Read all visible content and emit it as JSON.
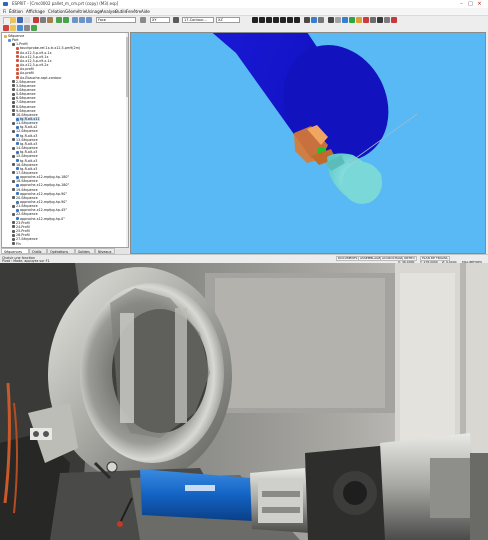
{
  "window": {
    "title": "ESPRIT - [Cmc0002 pallet_m_cm.prt (copy) (M3).esp]",
    "controls": [
      "minimize",
      "maximize",
      "close"
    ]
  },
  "menu": {
    "items": [
      "Fi",
      "Édition",
      "Affichage",
      "Création",
      "Géométrie",
      "Usinage",
      "Analyse",
      "Outils",
      "Fenêtre",
      "Aide"
    ]
  },
  "toolbar": {
    "combos": [
      {
        "name": "view",
        "value": "Face"
      },
      {
        "name": "grid",
        "value": "XY"
      },
      {
        "name": "workplane",
        "value": "XY"
      },
      {
        "name": "operation",
        "value": "17-Contour..."
      },
      {
        "name": "tool",
        "value": "XZ"
      }
    ]
  },
  "tree": {
    "rows": [
      {
        "label": "Séquence",
        "depth": 0,
        "icon": "folder-icon"
      },
      {
        "label": "Part",
        "depth": 1,
        "icon": "part-icon"
      },
      {
        "label": "1-Profil",
        "depth": 2,
        "icon": "op-icon"
      },
      {
        "label": "touchprobe-ref-1x-tr-x12,5-pm9(2m)",
        "depth": 3,
        "icon": "probe-icon"
      },
      {
        "label": "Ax-x12,5-p-x9-x-1x",
        "depth": 3,
        "icon": "probe-icon"
      },
      {
        "label": "Ax-x12,5-p-x9-1x",
        "depth": 3,
        "icon": "probe-icon"
      },
      {
        "label": "Ax-x12,5-p-x9-x-1x",
        "depth": 3,
        "icon": "probe-icon"
      },
      {
        "label": "Ax-x12,5-p-x9-2x",
        "depth": 3,
        "icon": "probe-icon"
      },
      {
        "label": "Ax-profil",
        "depth": 3,
        "icon": "probe-icon"
      },
      {
        "label": "Ax-profil",
        "depth": 3,
        "icon": "probe-icon"
      },
      {
        "label": "Ax-Ébauche-rapt-contour",
        "depth": 3,
        "icon": "probe-icon"
      },
      {
        "label": "2-Séquence",
        "depth": 2,
        "icon": "op-icon"
      },
      {
        "label": "3-Séquence",
        "depth": 2,
        "icon": "op-icon"
      },
      {
        "label": "4-Séquence",
        "depth": 2,
        "icon": "op-icon"
      },
      {
        "label": "5-Séquence",
        "depth": 2,
        "icon": "op-icon"
      },
      {
        "label": "6-Séquence",
        "depth": 2,
        "icon": "op-icon"
      },
      {
        "label": "7-Séquence",
        "depth": 2,
        "icon": "op-icon"
      },
      {
        "label": "8-Séquence",
        "depth": 2,
        "icon": "op-icon"
      },
      {
        "label": "9-Séquence",
        "depth": 2,
        "icon": "op-icon"
      },
      {
        "label": "10-Séquence",
        "depth": 2,
        "icon": "op-icon"
      },
      {
        "label": "tg-R-alt-x11",
        "depth": 3,
        "icon": "tool-icon",
        "selected": true
      },
      {
        "label": "11-Séquence",
        "depth": 2,
        "icon": "op-icon"
      },
      {
        "label": "tg-R-alt-x2",
        "depth": 3,
        "icon": "tool-icon"
      },
      {
        "label": "12-Séquence",
        "depth": 2,
        "icon": "op-icon"
      },
      {
        "label": "tg-R-alt-x3",
        "depth": 3,
        "icon": "tool-icon"
      },
      {
        "label": "13-Séquence",
        "depth": 2,
        "icon": "op-icon"
      },
      {
        "label": "tg-R-alt-x3",
        "depth": 3,
        "icon": "tool-icon"
      },
      {
        "label": "14-Séquence",
        "depth": 2,
        "icon": "op-icon"
      },
      {
        "label": "tg-R-alt-x3",
        "depth": 3,
        "icon": "tool-icon"
      },
      {
        "label": "15-Séquence",
        "depth": 2,
        "icon": "op-icon"
      },
      {
        "label": "tg-R-alt-x3",
        "depth": 3,
        "icon": "tool-icon"
      },
      {
        "label": "16-Séquence",
        "depth": 2,
        "icon": "op-icon"
      },
      {
        "label": "tg-R-alt-x3",
        "depth": 3,
        "icon": "tool-icon"
      },
      {
        "label": "17-Séquence",
        "depth": 2,
        "icon": "op-icon"
      },
      {
        "label": "approche-x12-mpfpg-hp-180°",
        "depth": 3,
        "icon": "tool-icon"
      },
      {
        "label": "18-Séquence",
        "depth": 2,
        "icon": "op-icon"
      },
      {
        "label": "approche-x12-mpfpg-hp-180°",
        "depth": 3,
        "icon": "tool-icon"
      },
      {
        "label": "19-Séquence",
        "depth": 2,
        "icon": "op-icon"
      },
      {
        "label": "approche-x12-mpfpg-hp-90°",
        "depth": 3,
        "icon": "tool-icon"
      },
      {
        "label": "20-Séquence",
        "depth": 2,
        "icon": "op-icon"
      },
      {
        "label": "approche-x12-mpfpg-hp-90°",
        "depth": 3,
        "icon": "tool-icon"
      },
      {
        "label": "21-Séquence",
        "depth": 2,
        "icon": "op-icon"
      },
      {
        "label": "approche-x12-mpfpg-hp-45°",
        "depth": 3,
        "icon": "tool-icon"
      },
      {
        "label": "22-Séquence",
        "depth": 2,
        "icon": "op-icon"
      },
      {
        "label": "approche-x12-mpfpg-hp-0°",
        "depth": 3,
        "icon": "tool-icon"
      },
      {
        "label": "23-Profil",
        "depth": 2,
        "icon": "op-icon"
      },
      {
        "label": "24-Profil",
        "depth": 2,
        "icon": "op-icon"
      },
      {
        "label": "25-Profil",
        "depth": 2,
        "icon": "op-icon"
      },
      {
        "label": "26-Profil",
        "depth": 2,
        "icon": "op-icon"
      },
      {
        "label": "27-Séquence",
        "depth": 2,
        "icon": "op-icon"
      },
      {
        "label": "Fin",
        "depth": 2,
        "icon": "op-icon"
      }
    ]
  },
  "bottom_tabs": [
    "Séquences",
    "Outils",
    "Opérations",
    "Solides",
    "Niveaux"
  ],
  "status": {
    "line1": "Choisir une fonction",
    "line2": "Pivot : Mode, appuyez sur F1",
    "cells": [
      "DOCUMENTS",
      "ASSEMBLAGE",
      "ACCROCHAGE",
      "ORTHO",
      "PLAN DE TRAVAIL"
    ],
    "coords": [
      "X: 36.0000",
      "Y: 178.0000",
      "Z: 0.0000",
      "MILLIMÈTRES"
    ]
  },
  "colors": {
    "viewport_bg": "#58b9f4",
    "stock": "#1a1ad8",
    "part": "#7fdede",
    "tool": "#e07a36",
    "highlight": "#22c02a"
  }
}
